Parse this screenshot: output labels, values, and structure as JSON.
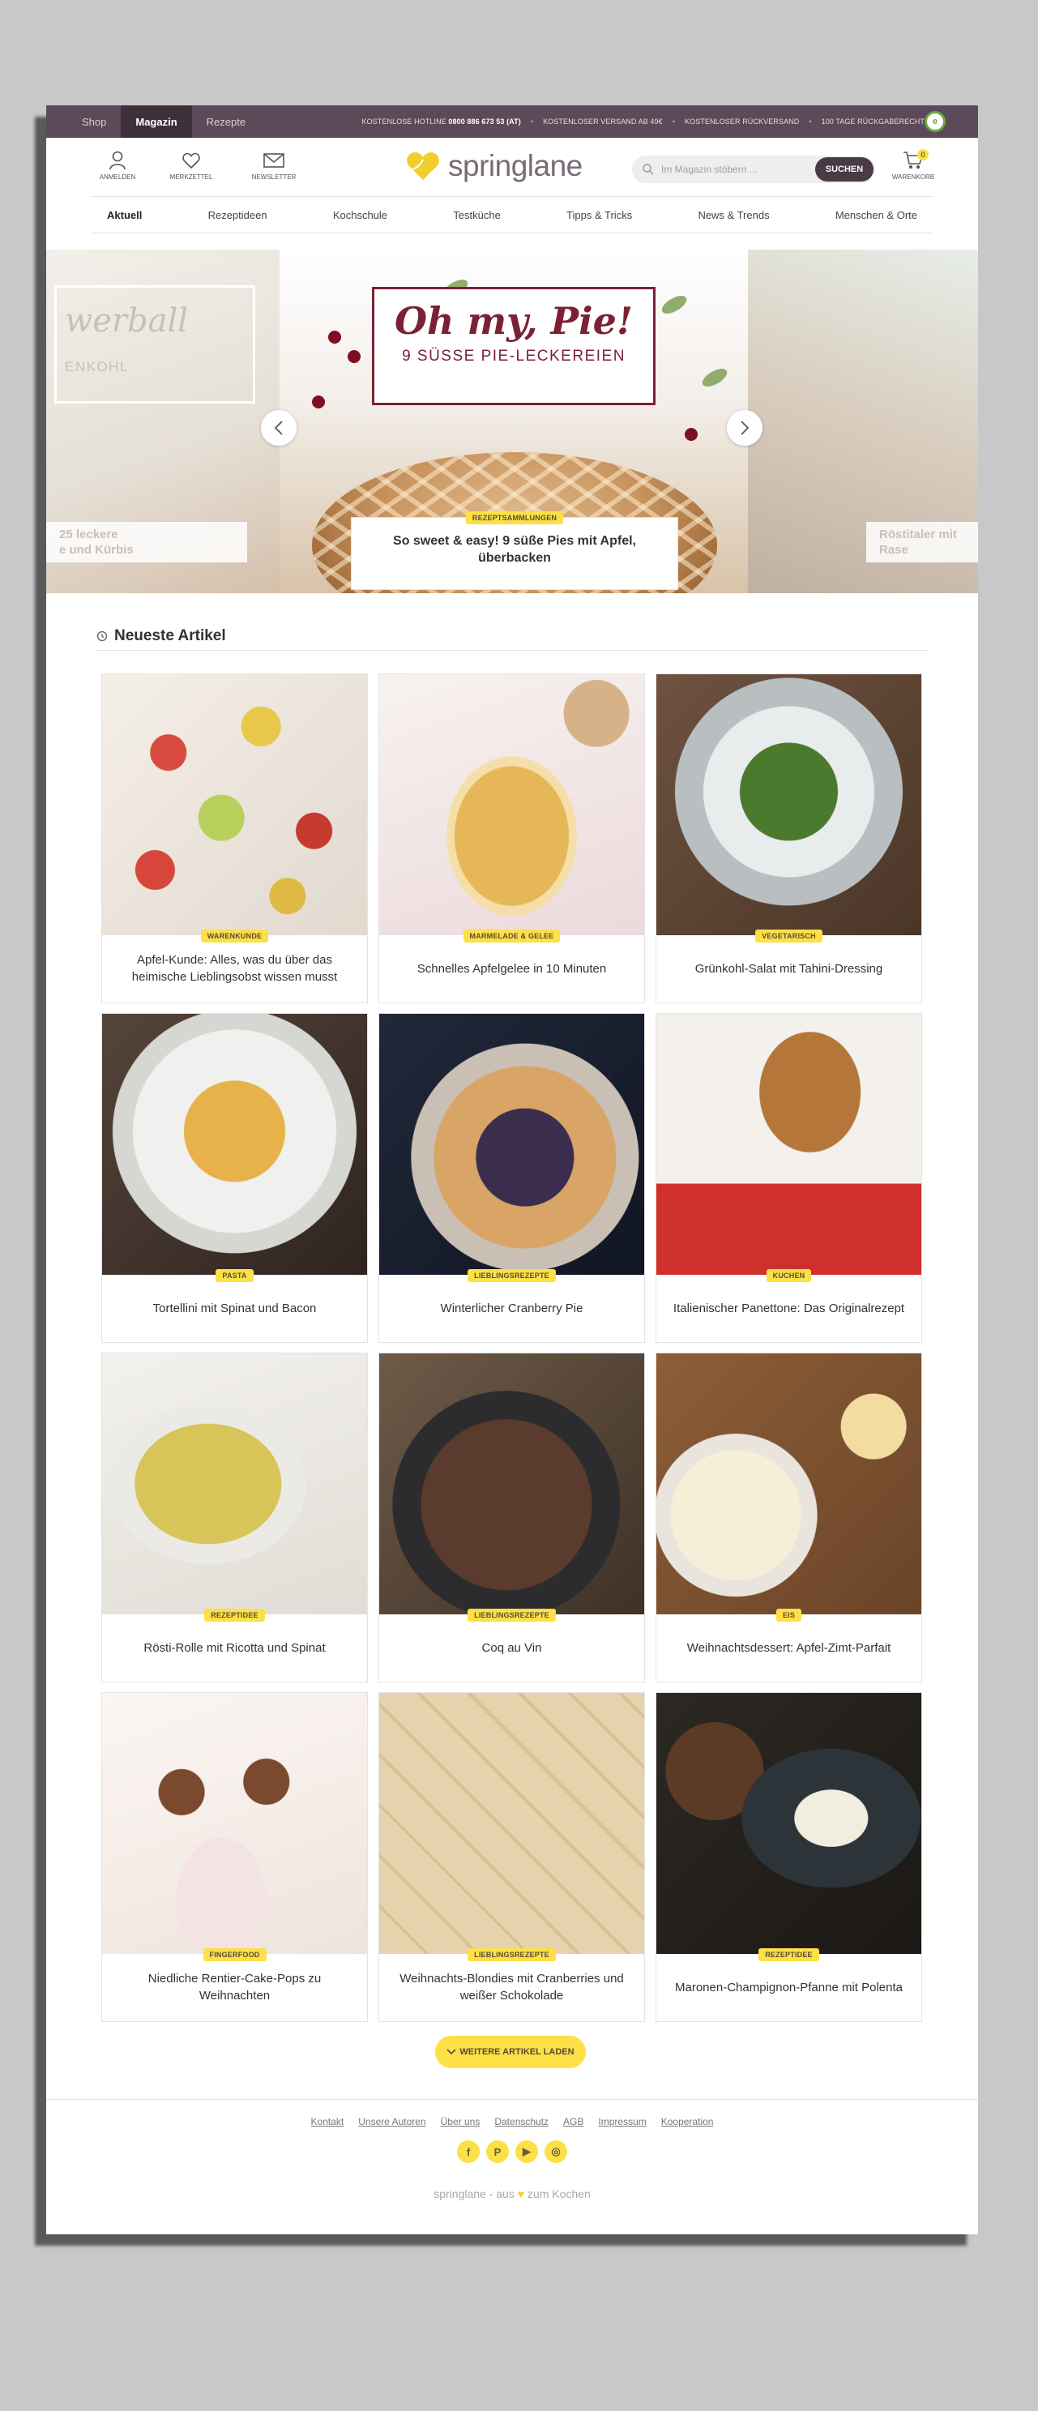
{
  "topbar": {
    "nav": [
      {
        "label": "Shop",
        "active": false
      },
      {
        "label": "Magazin",
        "active": true
      },
      {
        "label": "Rezepte",
        "active": false
      }
    ],
    "hotline_label": "KOSTENLOSE HOTLINE",
    "hotline_number": "0800 886 673 53 (AT)",
    "shipping": "KOSTENLOSER VERSAND AB 49€",
    "returns": "KOSTENLOSER RÜCKVERSAND",
    "return_right": "100 TAGE RÜCKGABERECHT"
  },
  "header": {
    "icons": [
      {
        "label": "ANMELDEN",
        "icon": "user-icon"
      },
      {
        "label": "MERKZETTEL",
        "icon": "heart-icon"
      },
      {
        "label": "NEWSLETTER",
        "icon": "mail-icon"
      }
    ],
    "logo_text": "springlane",
    "search_placeholder": "Im Magazin stöbern ...",
    "search_button": "SUCHEN",
    "cart_label": "WARENKORB",
    "cart_count": "0"
  },
  "categories": [
    {
      "label": "Aktuell",
      "active": true
    },
    {
      "label": "Rezeptideen",
      "active": false
    },
    {
      "label": "Kochschule",
      "active": false
    },
    {
      "label": "Testküche",
      "active": false
    },
    {
      "label": "Tipps & Tricks",
      "active": false
    },
    {
      "label": "News & Trends",
      "active": false
    },
    {
      "label": "Menschen & Orte",
      "active": false
    }
  ],
  "hero": {
    "left_title": "werball",
    "left_subtitle": "ENKOHL",
    "left_caption_1": "25 leckere",
    "left_caption_2": "e und Kürbis",
    "center_title": "Oh my, Pie!",
    "center_subtitle": "9 SÜSSE PIE-LECKEREIEN",
    "center_badge": "REZEPTSAMMLUNGEN",
    "center_caption": "So sweet & easy! 9 süße Pies mit Apfel, überbacken",
    "right_caption_1": "Röstitaler mit",
    "right_caption_2": "Rase"
  },
  "section": {
    "title": "Neueste Artikel"
  },
  "articles": [
    {
      "category": "WARENKUNDE",
      "title": "Apfel-Kunde: Alles, was du über das heimische Lieblingsobst wissen musst"
    },
    {
      "category": "MARMELADE & GELEE",
      "title": "Schnelles Apfelgelee in 10 Minuten"
    },
    {
      "category": "VEGETARISCH",
      "title": "Grünkohl-Salat mit Tahini-Dressing"
    },
    {
      "category": "PASTA",
      "title": "Tortellini mit Spinat und Bacon"
    },
    {
      "category": "LIEBLINGSREZEPTE",
      "title": "Winterlicher Cranberry Pie"
    },
    {
      "category": "KUCHEN",
      "title": "Italienischer Panettone: Das Originalrezept"
    },
    {
      "category": "REZEPTIDEE",
      "title": "Rösti-Rolle mit Ricotta und Spinat"
    },
    {
      "category": "LIEBLINGSREZEPTE",
      "title": "Coq au Vin"
    },
    {
      "category": "EIS",
      "title": "Weihnachtsdessert: Apfel-Zimt-Parfait"
    },
    {
      "category": "FINGERFOOD",
      "title": "Niedliche Rentier-Cake-Pops zu Weihnachten"
    },
    {
      "category": "LIEBLINGSREZEPTE",
      "title": "Weihnachts-Blondies mit Cranberries und weißer Schokolade"
    },
    {
      "category": "REZEPTIDEE",
      "title": "Maronen-Champignon-Pfanne mit Polenta"
    }
  ],
  "load_more": "WEITERE ARTIKEL LADEN",
  "footer": {
    "links": [
      "Kontakt",
      "Unsere Autoren",
      "Über uns",
      "Datenschutz",
      "AGB",
      "Impressum",
      "Kooperation"
    ],
    "social": [
      {
        "icon": "facebook-icon",
        "glyph": "f"
      },
      {
        "icon": "pinterest-icon",
        "glyph": "P"
      },
      {
        "icon": "youtube-icon",
        "glyph": "▶"
      },
      {
        "icon": "instagram-icon",
        "glyph": "◎"
      }
    ],
    "tagline_before": "springlane - aus",
    "tagline_after": "zum Kochen"
  },
  "colors": {
    "topbar": "#5c4a58",
    "accent_yellow": "#fce046",
    "pie_red": "#7b2136"
  }
}
